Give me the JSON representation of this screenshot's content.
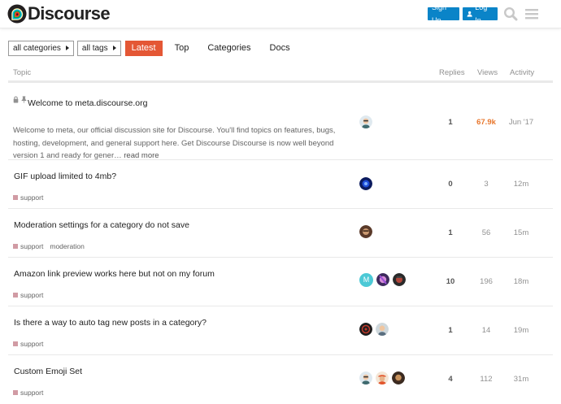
{
  "header": {
    "logo_text": "Discourse",
    "signup_label": "Sign Up",
    "login_label": "Log In"
  },
  "nav": {
    "category_filter": "all categories",
    "tag_filter": "all tags",
    "tabs": [
      "Latest",
      "Top",
      "Categories",
      "Docs"
    ]
  },
  "columns": {
    "topic": "Topic",
    "replies": "Replies",
    "views": "Views",
    "activity": "Activity"
  },
  "topics": [
    {
      "title": "Welcome to meta.discourse.org",
      "excerpt": "Welcome to meta, our official discussion site for Discourse. You'll find topics on features, bugs, hosting, development, and general support here. Get Discourse Discourse is now well beyond version 1 and ready for gener…",
      "read_more": "read more",
      "replies": "1",
      "views": "67.9k",
      "activity": "Jun '17"
    },
    {
      "title": "GIF upload limited to 4mb?",
      "category": "support",
      "replies": "0",
      "views": "3",
      "activity": "12m"
    },
    {
      "title": "Moderation settings for a category do not save",
      "category": "support",
      "tag": "moderation",
      "replies": "1",
      "views": "56",
      "activity": "15m"
    },
    {
      "title": "Amazon link preview works here but not on my forum",
      "category": "support",
      "avatar_letter": "M",
      "replies": "10",
      "views": "196",
      "activity": "18m"
    },
    {
      "title": "Is there a way to auto tag new posts in a category?",
      "category": "support",
      "replies": "1",
      "views": "14",
      "activity": "19m"
    },
    {
      "title": "Custom Emoji Set",
      "category": "support",
      "replies": "4",
      "views": "112",
      "activity": "31m"
    }
  ],
  "colors": {
    "accent": "#e45735",
    "primary_button": "#0a84c8",
    "hot_views": "#e8772d",
    "support_category": "#d19ba4"
  },
  "icons": [
    "lock-icon",
    "pin-icon",
    "user-icon",
    "search-icon",
    "hamburger-menu-icon",
    "caret-right-icon"
  ]
}
